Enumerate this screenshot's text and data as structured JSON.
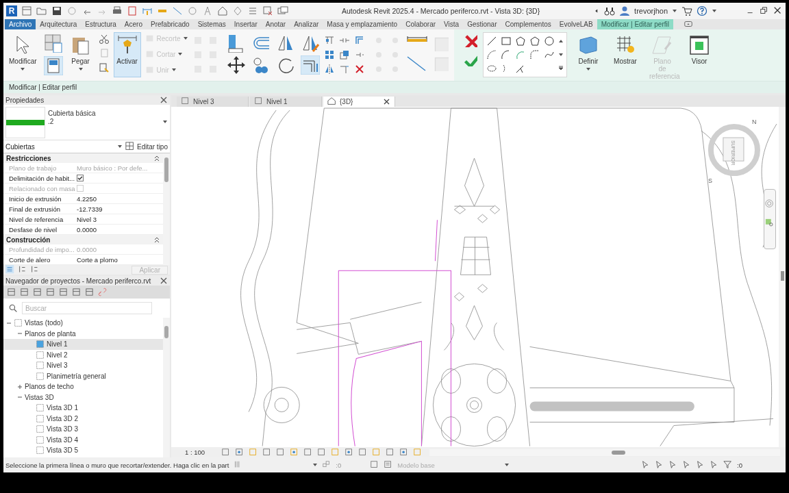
{
  "title_bar": {
    "logo": "R",
    "title": "Autodesk Revit 2025.4 - Mercado periferco.rvt - Vista 3D: {3D}",
    "user": "trevorjhon"
  },
  "ribbon_tabs": [
    {
      "label": "Archivo",
      "kind": "file",
      "selected": false
    },
    {
      "label": "Arquitectura",
      "kind": "tab",
      "selected": false
    },
    {
      "label": "Estructura",
      "kind": "tab",
      "selected": false
    },
    {
      "label": "Acero",
      "kind": "tab",
      "selected": false
    },
    {
      "label": "Prefabricado",
      "kind": "tab",
      "selected": false
    },
    {
      "label": "Sistemas",
      "kind": "tab",
      "selected": false
    },
    {
      "label": "Insertar",
      "kind": "tab",
      "selected": false
    },
    {
      "label": "Anotar",
      "kind": "tab",
      "selected": false
    },
    {
      "label": "Analizar",
      "kind": "tab",
      "selected": false
    },
    {
      "label": "Masa y emplazamiento",
      "kind": "tab",
      "selected": false
    },
    {
      "label": "Colaborar",
      "kind": "tab",
      "selected": false
    },
    {
      "label": "Vista",
      "kind": "tab",
      "selected": false
    },
    {
      "label": "Gestionar",
      "kind": "tab",
      "selected": false
    },
    {
      "label": "Complementos",
      "kind": "tab",
      "selected": false
    },
    {
      "label": "EvolveLAB",
      "kind": "tab",
      "selected": false
    },
    {
      "label": "Modificar | Editar perfil",
      "kind": "contextual",
      "selected": true
    }
  ],
  "ribbon": {
    "select": {
      "label": "Modificar"
    },
    "paste": {
      "label": "Pegar"
    },
    "activate": {
      "label": "Activar",
      "active": true
    },
    "geometry": [
      {
        "label": "Recorte",
        "disabled": true
      },
      {
        "label": "Cortar",
        "disabled": true
      },
      {
        "label": "Unir",
        "disabled": true
      }
    ],
    "mode": [
      {
        "label": "Definir",
        "disabled": false
      },
      {
        "label": "Mostrar",
        "disabled": false
      },
      {
        "label": "Plano de referencia",
        "disabled": true
      },
      {
        "label": "Visor",
        "disabled": false
      }
    ]
  },
  "options_bar": {
    "label": "Modificar | Editar perfil"
  },
  "properties": {
    "title": "Propiedades",
    "type_name": "Cubierta básica",
    "type_variant": ".2",
    "category": "Cubiertas",
    "edit_type": "Editar tipo",
    "groups": [
      {
        "name": "Restricciones",
        "rows": [
          {
            "label": "Plano de trabajo",
            "kind": "text",
            "value": "Muro básico : Por defe...",
            "disabled": true
          },
          {
            "label": "Delimitación de habit...",
            "kind": "checkbox",
            "checked": true,
            "disabled": false
          },
          {
            "label": "Relacionado con masa",
            "kind": "checkbox",
            "checked": false,
            "disabled": true
          },
          {
            "label": "Inicio de extrusión",
            "kind": "text",
            "value": "4.2250",
            "disabled": false
          },
          {
            "label": "Final de extrusión",
            "kind": "text",
            "value": "-12.7339",
            "disabled": false
          },
          {
            "label": "Nivel de referencia",
            "kind": "text",
            "value": "Nivel 3",
            "disabled": false
          },
          {
            "label": "Desfase de nivel",
            "kind": "text",
            "value": "0.0000",
            "disabled": false
          }
        ]
      },
      {
        "name": "Construcción",
        "rows": [
          {
            "label": "Profundidad de impo...",
            "kind": "text",
            "value": "0.0000",
            "disabled": true
          },
          {
            "label": "Corte de alero",
            "kind": "text",
            "value": "Corte a plomo",
            "disabled": false
          }
        ]
      }
    ],
    "apply": "Aplicar"
  },
  "project_browser": {
    "title": "Navegador de proyectos - Mercado periferco.rvt",
    "search_placeholder": "Buscar",
    "tree": [
      {
        "label": "Vistas (todo)",
        "expanded": true,
        "selected": false,
        "children": [
          {
            "label": "Planos de planta",
            "expanded": true,
            "selected": false,
            "children": [
              {
                "label": "Nivel 1",
                "selected": true
              },
              {
                "label": "Nivel 2",
                "selected": false
              },
              {
                "label": "Nivel 3",
                "selected": false
              },
              {
                "label": "Planimetría general",
                "selected": false
              }
            ]
          },
          {
            "label": "Planos de techo",
            "expanded": false,
            "selected": false
          },
          {
            "label": "Vistas 3D",
            "expanded": true,
            "selected": false,
            "children": [
              {
                "label": "Vista 3D 1",
                "selected": false
              },
              {
                "label": "Vista 3D 2",
                "selected": false
              },
              {
                "label": "Vista 3D 3",
                "selected": false
              },
              {
                "label": "Vista 3D 4",
                "selected": false
              },
              {
                "label": "Vista 3D 5",
                "selected": false
              }
            ]
          }
        ]
      }
    ]
  },
  "view_tabs": [
    {
      "label": "Nivel 3",
      "selected": false
    },
    {
      "label": "Nivel 1",
      "selected": false
    },
    {
      "label": "{3D}",
      "selected": true
    }
  ],
  "view_cube": {
    "face": "SUPERIOR",
    "compass": [
      "N",
      "S"
    ]
  },
  "view_bar": {
    "scale": "1 : 100"
  },
  "status_bar": {
    "message": "Seleccione la primera línea o muro que recortar/extender. Haga clic en la part",
    "worksets": ":0",
    "design_option": "Modelo base",
    "filter_count": ":0"
  }
}
